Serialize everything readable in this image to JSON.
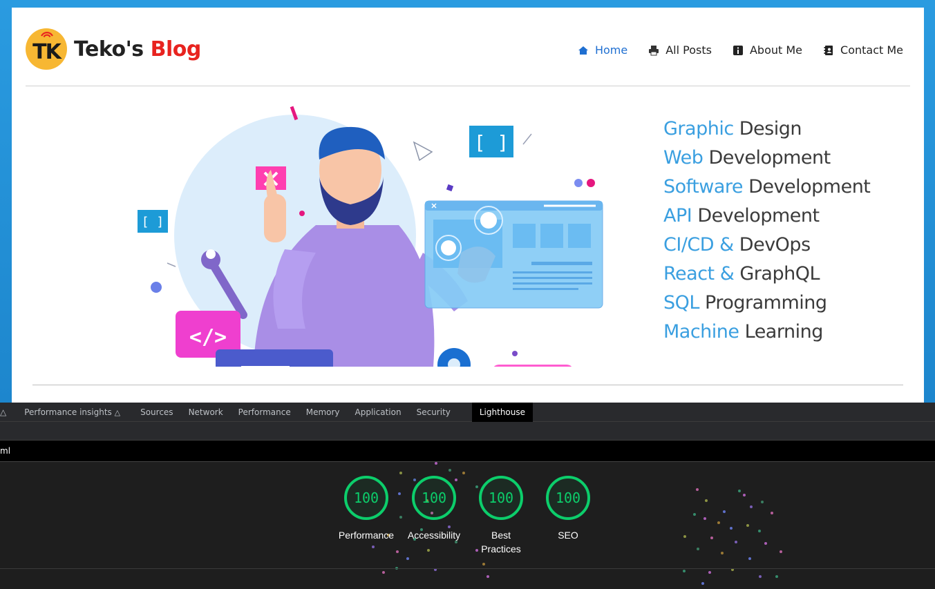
{
  "site": {
    "logo_initials": "TK",
    "brand_part1": "Teko's",
    "brand_part2": "Blog",
    "nav": [
      {
        "label": "Home",
        "icon": "home-icon",
        "active": true
      },
      {
        "label": "All Posts",
        "icon": "printer-icon",
        "active": false
      },
      {
        "label": "About Me",
        "icon": "info-icon",
        "active": false
      },
      {
        "label": "Contact Me",
        "icon": "address-book-icon",
        "active": false
      }
    ],
    "skills": [
      {
        "highlight": "Graphic",
        "rest": "Design"
      },
      {
        "highlight": "Web",
        "rest": "Development"
      },
      {
        "highlight": "Software",
        "rest": "Development"
      },
      {
        "highlight": "API",
        "rest": "Development"
      },
      {
        "highlight": "CI/CD &",
        "rest": "DevOps"
      },
      {
        "highlight": "React &",
        "rest": "GraphQL"
      },
      {
        "highlight": "SQL",
        "rest": "Programming"
      },
      {
        "highlight": "Machine",
        "rest": "Learning"
      }
    ],
    "colors": {
      "accent": "#3a9fe0",
      "brand_red": "#e8231f",
      "nav_active": "#1f6fd1"
    }
  },
  "devtools": {
    "tabs": [
      {
        "label": "Performance insights",
        "flask": true,
        "active": false
      },
      {
        "label": "Sources",
        "active": false
      },
      {
        "label": "Network",
        "active": false
      },
      {
        "label": "Performance",
        "active": false
      },
      {
        "label": "Memory",
        "active": false
      },
      {
        "label": "Application",
        "active": false
      },
      {
        "label": "Security",
        "active": false
      },
      {
        "label": "Lighthouse",
        "active": true
      }
    ],
    "url_fragment": "ml",
    "scores": [
      {
        "label": "Performance",
        "score": "100"
      },
      {
        "label": "Accessibility",
        "score": "100"
      },
      {
        "label": "Best Practices",
        "score": "100"
      },
      {
        "label": "SEO",
        "score": "100"
      }
    ],
    "colors": {
      "pass": "#0cce6b"
    }
  }
}
